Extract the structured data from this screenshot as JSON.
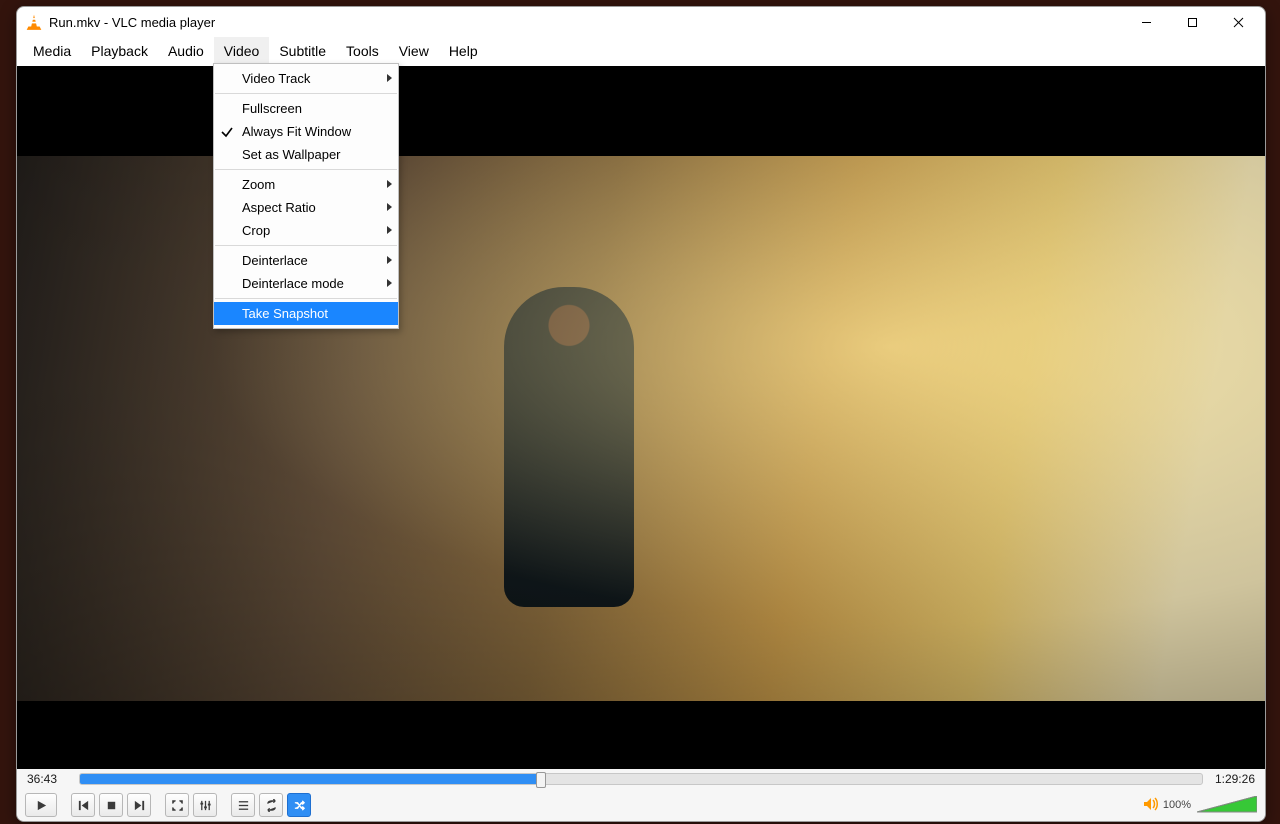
{
  "title": "Run.mkv - VLC media player",
  "menubar": [
    "Media",
    "Playback",
    "Audio",
    "Video",
    "Subtitle",
    "Tools",
    "View",
    "Help"
  ],
  "open_menu_index": 3,
  "video_menu": {
    "items": [
      {
        "label": "Video Track",
        "submenu": true
      },
      {
        "sep": true
      },
      {
        "label": "Fullscreen"
      },
      {
        "label": "Always Fit Window",
        "checked": true
      },
      {
        "label": "Set as Wallpaper"
      },
      {
        "sep": true
      },
      {
        "label": "Zoom",
        "submenu": true
      },
      {
        "label": "Aspect Ratio",
        "submenu": true
      },
      {
        "label": "Crop",
        "submenu": true
      },
      {
        "sep": true
      },
      {
        "label": "Deinterlace",
        "submenu": true
      },
      {
        "label": "Deinterlace mode",
        "submenu": true
      },
      {
        "sep": true
      },
      {
        "label": "Take Snapshot",
        "highlight": true
      }
    ]
  },
  "playback": {
    "elapsed": "36:43",
    "total": "1:29:26",
    "progress_percent": 41
  },
  "volume": {
    "percent_label": "100%",
    "level": 100
  },
  "controls": {
    "play": "Play",
    "prev": "Previous",
    "stop": "Stop",
    "next": "Next",
    "fullscreen": "Fullscreen",
    "ext": "Extended settings",
    "playlist": "Playlist",
    "loop": "Loop",
    "shuffle": "Random"
  }
}
